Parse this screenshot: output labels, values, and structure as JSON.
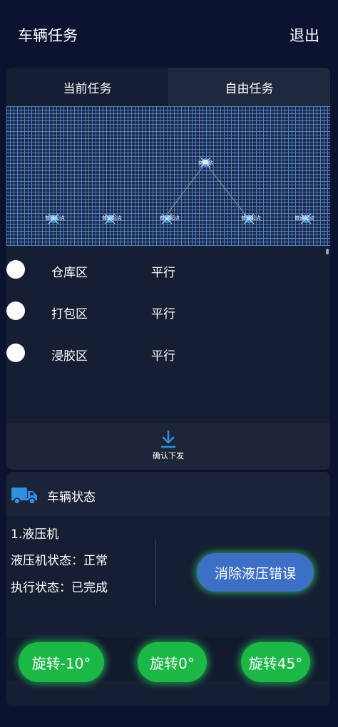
{
  "header": {
    "title": "车辆任务",
    "logout_label": "退出"
  },
  "tabs": [
    {
      "label": "当前任务",
      "active": true
    },
    {
      "label": "自由任务",
      "active": false
    }
  ],
  "map": {
    "charging_station": {
      "label": "充电站",
      "icon": "robot-icon"
    },
    "waypoints": [
      {
        "label": "普通起点",
        "icon": "robot-icon"
      },
      {
        "label": "普通起点",
        "icon": "robot-icon"
      },
      {
        "label": "普通起点",
        "icon": "robot-icon"
      },
      {
        "label": "普通起点",
        "icon": "robot-icon"
      },
      {
        "label": "普通起点",
        "icon": "robot-icon"
      }
    ]
  },
  "zones": [
    {
      "name": "仓库区",
      "mode": "平行"
    },
    {
      "name": "打包区",
      "mode": "平行"
    },
    {
      "name": "浸胶区",
      "mode": "平行"
    }
  ],
  "confirm": {
    "label": "确认下发",
    "icon": "download-arrow-icon"
  },
  "vehicle_status": {
    "title": "车辆状态",
    "icon": "truck-icon",
    "device_name": "1.液压机",
    "hydraulic_state": "液压机状态：正常",
    "exec_state": "执行状态：已完成",
    "clear_error_label": "消除液压错误"
  },
  "rotate_buttons": [
    {
      "label": "旋转-10°"
    },
    {
      "label": "旋转0°"
    },
    {
      "label": "旋转45°"
    }
  ],
  "colors": {
    "background": "#0b1330",
    "card": "#161e33",
    "accent_blue": "#3c6fc5",
    "accent_green": "#1ab844",
    "icon_blue": "#2f8fe0"
  }
}
